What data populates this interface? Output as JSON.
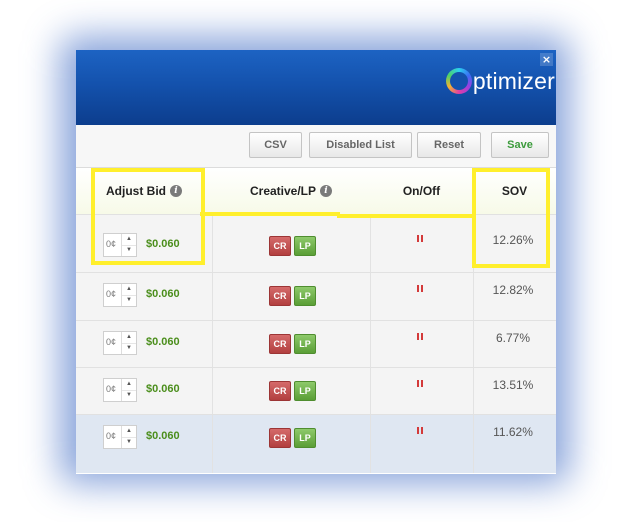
{
  "window": {
    "close_glyph": "×",
    "logo_text": "ptimizer"
  },
  "toolbar": {
    "csv_label": "CSV",
    "disabled_list_label": "Disabled List",
    "reset_label": "Reset",
    "save_label": "Save"
  },
  "table": {
    "columns": {
      "adjust_bid": "Adjust Bid",
      "creative_lp": "Creative/LP",
      "on_off": "On/Off",
      "sov": "SOV"
    },
    "info_glyph": "i",
    "rows": [
      {
        "stepper": "0¢",
        "bid": "$0.060",
        "cr": "CR",
        "lp": "LP",
        "sov": "12.26%"
      },
      {
        "stepper": "0¢",
        "bid": "$0.060",
        "cr": "CR",
        "lp": "LP",
        "sov": "12.82%"
      },
      {
        "stepper": "0¢",
        "bid": "$0.060",
        "cr": "CR",
        "lp": "LP",
        "sov": "6.77%"
      },
      {
        "stepper": "0¢",
        "bid": "$0.060",
        "cr": "CR",
        "lp": "LP",
        "sov": "13.51%"
      },
      {
        "stepper": "0¢",
        "bid": "$0.060",
        "cr": "CR",
        "lp": "LP",
        "sov": "11.62%"
      }
    ]
  },
  "icons": {
    "close": "close-icon",
    "logo": "optimizer-logo-ring",
    "info": "info-icon",
    "pause": "pause-icon",
    "arrow_up": "caret-up-icon",
    "arrow_down": "caret-down-icon"
  },
  "colors": {
    "header_blue": "#1452ad",
    "bid_green": "#4b8e1c",
    "cr_red": "#b23f3f",
    "lp_green": "#5a9e36",
    "pause_red": "#d33a3a",
    "highlight_yellow": "#ffef2c"
  }
}
